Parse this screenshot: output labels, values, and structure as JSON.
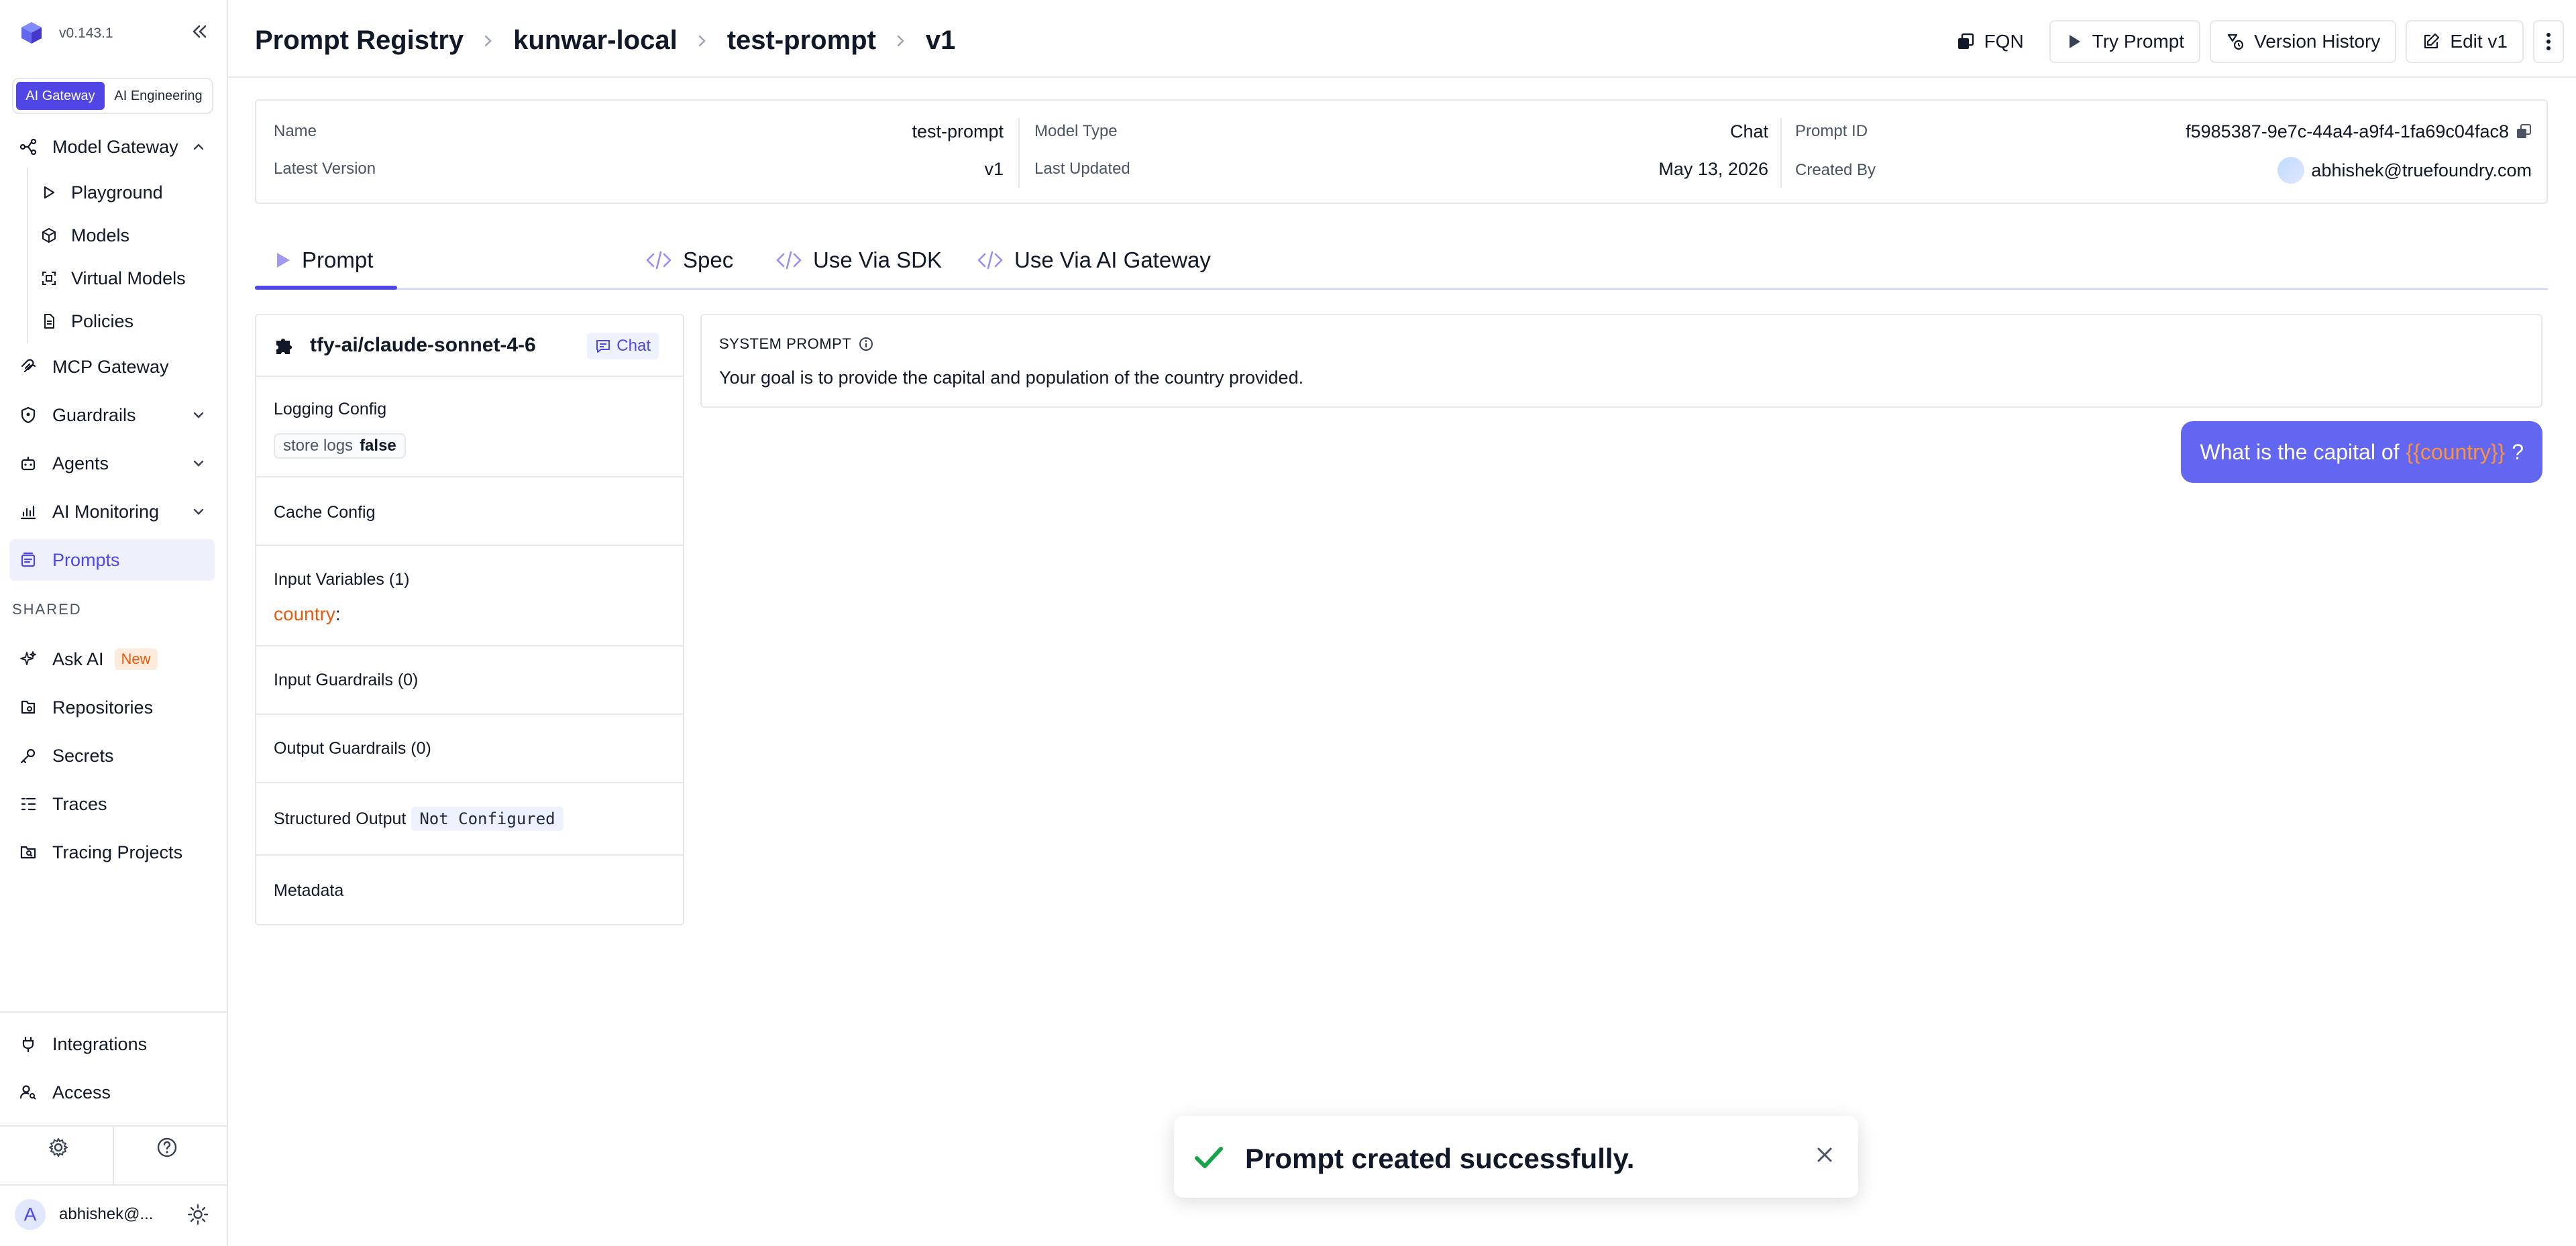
{
  "app": {
    "version": "v0.143.1"
  },
  "switcher": {
    "options": [
      "AI Gateway",
      "AI Engineering"
    ],
    "active": "AI Gateway"
  },
  "sidebar": {
    "model_gateway": "Model Gateway",
    "sub_items": [
      "Playground",
      "Models",
      "Virtual Models",
      "Policies"
    ],
    "mcp_gateway": "MCP Gateway",
    "guardrails": "Guardrails",
    "agents": "Agents",
    "ai_monitoring": "AI Monitoring",
    "prompts": "Prompts",
    "shared_label": "SHARED",
    "ask_ai": "Ask AI",
    "new_badge": "New",
    "repositories": "Repositories",
    "secrets": "Secrets",
    "traces": "Traces",
    "tracing_projects": "Tracing Projects",
    "integrations": "Integrations",
    "access": "Access",
    "user_initial": "A",
    "user_name": "abhishek@..."
  },
  "breadcrumb": [
    "Prompt Registry",
    "kunwar-local",
    "test-prompt",
    "v1"
  ],
  "header_actions": {
    "fqn": "FQN",
    "try_prompt": "Try Prompt",
    "version_history": "Version History",
    "edit": "Edit v1"
  },
  "info": {
    "name_label": "Name",
    "name_value": "test-prompt",
    "latest_version_label": "Latest Version",
    "latest_version_value": "v1",
    "model_type_label": "Model Type",
    "model_type_value": "Chat",
    "last_updated_label": "Last Updated",
    "last_updated_value": "May 13, 2026",
    "prompt_id_label": "Prompt ID",
    "prompt_id_value": "f5985387-9e7c-44a4-a9f4-1fa69c04fac8",
    "created_by_label": "Created By",
    "created_by_value": "abhishek@truefoundry.com"
  },
  "tabs": [
    "Prompt",
    "Spec",
    "Use Via SDK",
    "Use Via AI Gateway"
  ],
  "config": {
    "model": "tfy-ai/claude-sonnet-4-6",
    "chat_badge": "Chat",
    "logging_title": "Logging Config",
    "logging_key": "store logs",
    "logging_value": "false",
    "cache_title": "Cache Config",
    "input_vars_title": "Input Variables (1)",
    "input_var": "country",
    "input_var_colon": ":",
    "input_guardrails": "Input Guardrails (0)",
    "output_guardrails": "Output Guardrails (0)",
    "structured_output": "Structured Output",
    "structured_badge": "Not Configured",
    "metadata": "Metadata"
  },
  "system_prompt": {
    "label": "SYSTEM PROMPT",
    "text": "Your goal is to provide the capital and population of the country provided."
  },
  "user_message": {
    "before": "What is the capital of",
    "variable": "{{country}}",
    "after": "?"
  },
  "toast": {
    "message": "Prompt created successfully."
  },
  "colors": {
    "accent": "#4f46e5",
    "message_bubble": "#6366f1",
    "variable": "#ea580c",
    "success": "#16a34a"
  }
}
